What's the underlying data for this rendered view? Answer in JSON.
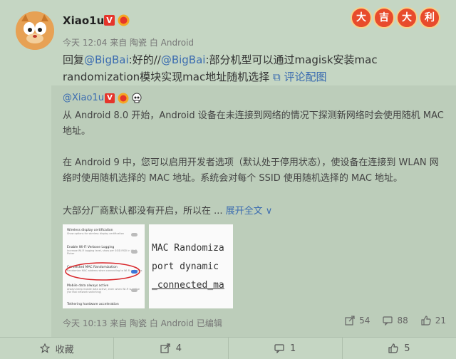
{
  "post": {
    "username": "Xiao1u",
    "verified_badge": "V",
    "stamps": [
      "大",
      "吉",
      "大",
      "利"
    ],
    "meta": "今天 12:04 来自 陶瓷 白 Android",
    "reply_prefix": "回复",
    "mention1": "@BigBai",
    "reply_mid": ":好的//",
    "mention2": "@BigBai",
    "reply_body": ":部分机型可以通过magisk安装mac randomization模块实现mac地址随机选择",
    "image_link": "评论配图"
  },
  "quote": {
    "username": "@Xiao1u",
    "verified_badge": "V",
    "para1": "从 Android 8.0 开始，Android 设备在未连接到网络的情况下探测新网络时会使用随机 MAC 地址。",
    "para2": "在 Android 9 中，您可以启用开发者选项（默认处于停用状态），使设备在连接到 WLAN 网络时使用随机选择的 MAC 地址。系统会对每个 SSID 使用随机选择的 MAC 地址。",
    "para3": "大部分厂商默认都没有开启，所以在 ...",
    "expand": "展开全文 ∨",
    "thumb1_settings": [
      {
        "title": "Wireless display certification",
        "sub": "Show options for wireless display certification"
      },
      {
        "title": "Enable Wi-Fi Verbose Logging",
        "sub": "Increase Wi-Fi logging level, show per SSID RSSI in Wi-Fi Picker"
      },
      {
        "title": "Connected MAC Randomization",
        "sub": "Randomize MAC address when connecting to Wi-Fi networks"
      },
      {
        "title": "Mobile data always active",
        "sub": "Always keep mobile data active, even when Wi-Fi is active (for fast network switching)"
      },
      {
        "title": "Tethering hardware acceleration",
        "sub": ""
      }
    ],
    "thumb2_lines": [
      "MAC Randomiza",
      "port dynamic",
      "_connected_ma"
    ],
    "meta": "今天 10:13 来自 陶瓷 白 Android  已编辑",
    "share_count": "54",
    "comment_count": "88",
    "like_count": "21"
  },
  "bottom_bar": {
    "favorite": "收藏",
    "share": "4",
    "comment": "1",
    "like": "5"
  },
  "colors": {
    "link": "#3b6cb0",
    "verified": "#e5352b",
    "stamp": "#e84b2c"
  }
}
